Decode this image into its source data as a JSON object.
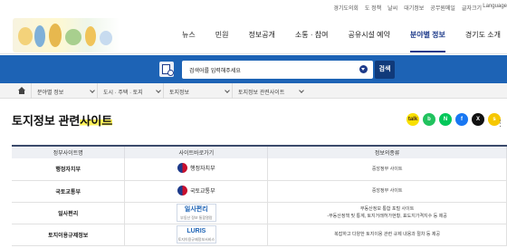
{
  "util": {
    "links": [
      "경기도의회",
      "도 정책",
      "날씨",
      "대기정보",
      "공무원메일",
      "글자크기"
    ],
    "lang": "Language"
  },
  "gnb": {
    "items": [
      "뉴스",
      "민원",
      "정보공개",
      "소통 · 참여",
      "공유시설 예약",
      "분야별 정보",
      "경기도 소개"
    ],
    "active_index": 5
  },
  "search": {
    "select_value": "검색어를 입력해주세요",
    "button_label": "검색"
  },
  "breadcrumb": [
    "분야별 정보",
    "도시 · 주택 · 토지",
    "토지정보",
    "토지정보 관련사이트"
  ],
  "page": {
    "title_part1": "토지정보 관련",
    "title_part2": "사이트"
  },
  "share": [
    {
      "name": "kakaotalk",
      "label": "talk",
      "color": "#f9e000",
      "text_color": "#3b1e1e"
    },
    {
      "name": "naver-band",
      "label": "b",
      "color": "#21c25e"
    },
    {
      "name": "naver",
      "label": "N",
      "color": "#03c75a"
    },
    {
      "name": "facebook",
      "label": "f",
      "color": "#1877f2"
    },
    {
      "name": "x",
      "label": "X",
      "color": "#111111"
    },
    {
      "name": "kakaostory",
      "label": "s",
      "color": "#f6c700"
    }
  ],
  "table": {
    "headers": [
      "정부사이트명",
      "사이트바로가기",
      "정보의종류"
    ],
    "rows": [
      {
        "org": "행정자치부",
        "logo": "행정자치부",
        "logo_type": "gov",
        "info": "중앙정부 사이트"
      },
      {
        "org": "국토교통부",
        "logo": "국토교통부",
        "logo_type": "gov",
        "info": "중앙정부 사이트"
      },
      {
        "org": "일사편리",
        "logo": "일사편리",
        "logo_sub": "부동산 정보 통합열람",
        "logo_type": "box",
        "info": "부동산정보 통합 포털 사이트",
        "info2": "-부동산정책 및 통계, 토지거래허가현황, 표도지가격지수 등 제공"
      },
      {
        "org": "토지이용규제정보",
        "logo": "LURIS",
        "logo_sub": "토지이용규제정보서비스",
        "logo_type": "box",
        "info": "복잡하고 다양한 토지이용 관련 규제 내용과 절차 등 제공"
      }
    ]
  },
  "colors": {
    "brand_blue": "#1d63b5",
    "navy": "#1d3a8a",
    "highlight": "#fff35a"
  }
}
